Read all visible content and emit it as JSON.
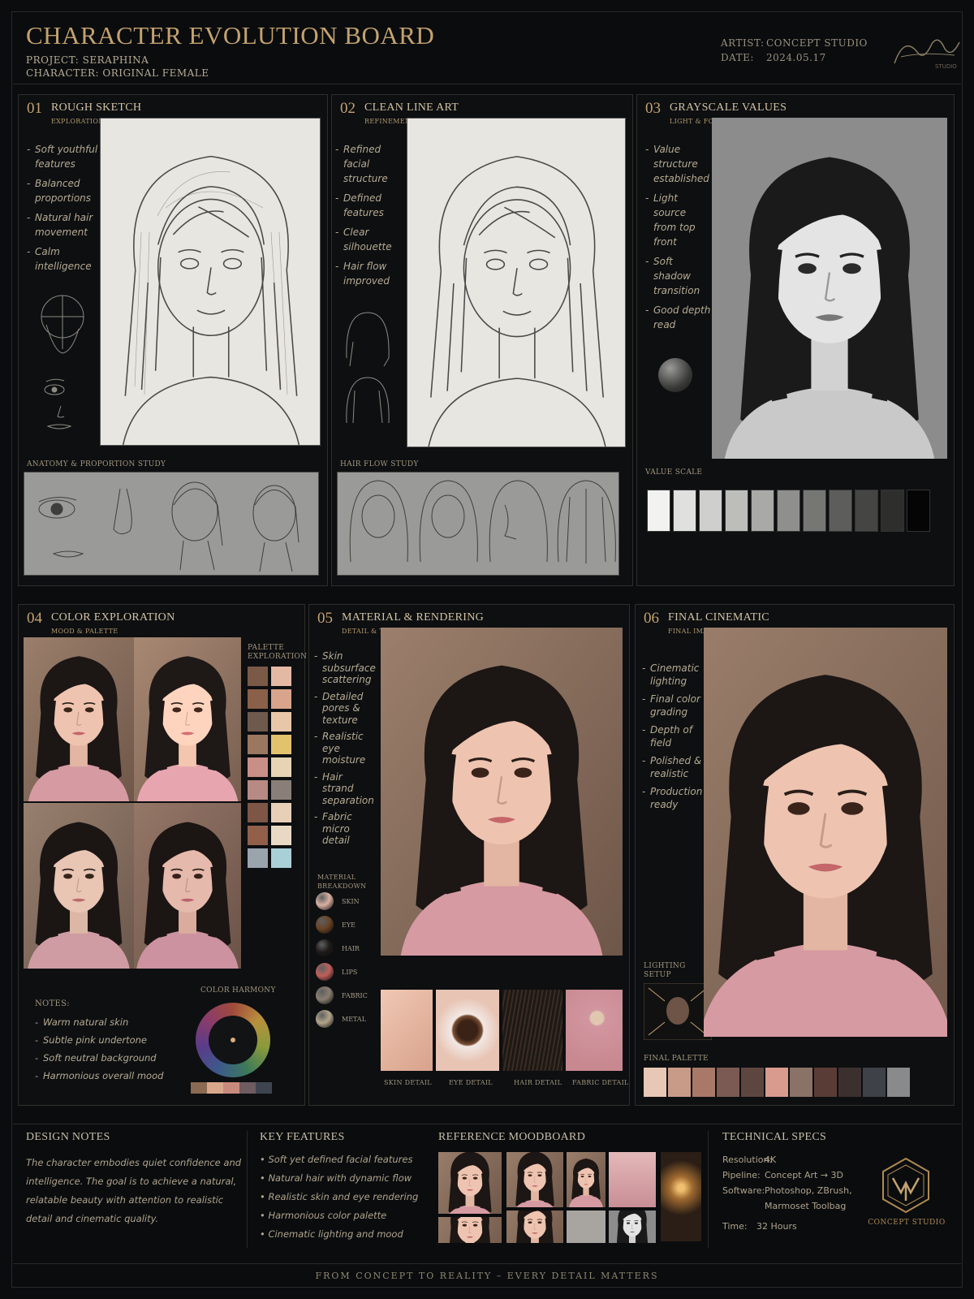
{
  "header": {
    "title": "CHARACTER EVOLUTION BOARD",
    "project": "PROJECT: SERAPHINA",
    "character": "CHARACTER: ORIGINAL FEMALE",
    "artist_label": "ARTIST:",
    "artist_value": "CONCEPT STUDIO",
    "date_label": "DATE:",
    "date_value": "2024.05.17",
    "signature_studio": "STUDIO"
  },
  "panels": {
    "p1": {
      "num": "01",
      "title": "ROUGH SKETCH",
      "sub": "EXPLORATION",
      "bullets": [
        "Soft youthful features",
        "Balanced proportions",
        "Natural hair movement",
        "Calm intelligence"
      ],
      "study_label": "ANATOMY & PROPORTION STUDY"
    },
    "p2": {
      "num": "02",
      "title": "CLEAN LINE ART",
      "sub": "REFINEMENT",
      "bullets": [
        "Refined facial structure",
        "Defined features",
        "Clear silhouette",
        "Hair flow improved"
      ],
      "study_label": "HAIR FLOW STUDY"
    },
    "p3": {
      "num": "03",
      "title": "GRAYSCALE VALUES",
      "sub": "LIGHT & FORM",
      "bullets": [
        "Value structure established",
        "Light source from top front",
        "Soft shadow transition",
        "Good depth read"
      ],
      "study_label": "VALUE SCALE",
      "value_scale": [
        "#f2f2f0",
        "#e0e0de",
        "#cfcfcd",
        "#bdbdbb",
        "#a9a9a7",
        "#8f8f8d",
        "#767674",
        "#5d5d5b",
        "#454543",
        "#2e2e2c",
        "#050505"
      ]
    },
    "p4": {
      "num": "04",
      "title": "COLOR EXPLORATION",
      "sub": "MOOD & PALETTE",
      "palette_label_1": "PALETTE",
      "palette_label_2": "EXPLORATION",
      "palette": [
        [
          "#7a5a46",
          "#e4b9a4"
        ],
        [
          "#8a6048",
          "#d9a48c"
        ],
        [
          "#6e5a4c",
          "#e8c7a9"
        ],
        [
          "#9a7860",
          "#e3c26e"
        ],
        [
          "#c98f86",
          "#e6d4b4"
        ],
        [
          "#b88a84",
          "#8a7f78"
        ],
        [
          "#7e5646",
          "#e8cfb8"
        ],
        [
          "#92604a",
          "#e9d9c4"
        ],
        [
          "#9aa4ac",
          "#a9d0d6"
        ]
      ],
      "notes_title": "NOTES:",
      "notes": [
        "Warm natural skin",
        "Subtle pink undertone",
        "Soft neutral background",
        "Harmonious overall mood"
      ],
      "harmony_label": "COLOR HARMONY",
      "harmony_swatches": [
        "#8a6a52",
        "#d9a88c",
        "#c98a7e",
        "#6e5c60",
        "#3e4450"
      ]
    },
    "p5": {
      "num": "05",
      "title": "MATERIAL & RENDERING",
      "sub": "DETAIL & TEXTURE",
      "bullets": [
        "Skin subsurface scattering",
        "Detailed pores & texture",
        "Realistic eye moisture",
        "Hair strand separation",
        "Fabric micro detail"
      ],
      "material_label_1": "MATERIAL",
      "material_label_2": "BREAKDOWN",
      "materials": [
        {
          "name": "SKIN",
          "color": "#d8b0a0"
        },
        {
          "name": "EYE",
          "color": "#6a4426"
        },
        {
          "name": "HAIR",
          "color": "#1e1a18"
        },
        {
          "name": "LIPS",
          "color": "#c0605c"
        },
        {
          "name": "FABRIC",
          "color": "#8a7e70"
        },
        {
          "name": "METAL",
          "color": "#b2a58a"
        }
      ],
      "details": [
        "SKIN DETAIL",
        "EYE DETAIL",
        "HAIR DETAIL",
        "FABRIC DETAIL"
      ]
    },
    "p6": {
      "num": "06",
      "title": "FINAL CINEMATIC",
      "sub": "FINAL IMAGE",
      "bullets": [
        "Cinematic lighting",
        "Final color grading",
        "Depth of field",
        "Polished & realistic",
        "Production ready"
      ],
      "lighting_label_1": "LIGHTING",
      "lighting_label_2": "SETUP",
      "palette_label": "FINAL PALETTE",
      "final_palette": [
        "#e7c7b6",
        "#c89a88",
        "#a87868",
        "#7a5a52",
        "#5e4640",
        "#d89b8e",
        "#8a7266",
        "#5a3c36",
        "#3c302e",
        "#3e4248",
        "#888a8c",
        "#0e0f10"
      ]
    }
  },
  "bottom": {
    "design_notes_title": "DESIGN NOTES",
    "design_notes_lines": [
      "The character embodies quiet confidence and",
      "intelligence. The goal is to achieve a natural,",
      "relatable beauty with attention to realistic",
      "detail and cinematic quality."
    ],
    "key_features_title": "KEY FEATURES",
    "key_features": [
      "Soft yet defined facial features",
      "Natural hair with dynamic flow",
      "Realistic skin and eye rendering",
      "Harmonious color palette",
      "Cinematic lighting and mood"
    ],
    "moodboard_title": "REFERENCE MOODBOARD",
    "specs_title": "TECHNICAL SPECS",
    "specs": [
      {
        "label": "Resolution:",
        "value": "4K"
      },
      {
        "label": "Pipeline:",
        "value": "Concept Art → 3D"
      },
      {
        "label": "Software:",
        "value": "Photoshop, ZBrush,"
      },
      {
        "label": "",
        "value": "Marmoset Toolbag"
      },
      {
        "label": "Time:",
        "value": "32 Hours"
      }
    ],
    "logo_text": "CONCEPT STUDIO"
  },
  "footer": "FROM CONCEPT TO REALITY  –  EVERY DETAIL MATTERS",
  "colors": {
    "accent_gold": "#c4a26e",
    "background": "#0a0c0e",
    "panel_border": "#2f2e2a"
  }
}
